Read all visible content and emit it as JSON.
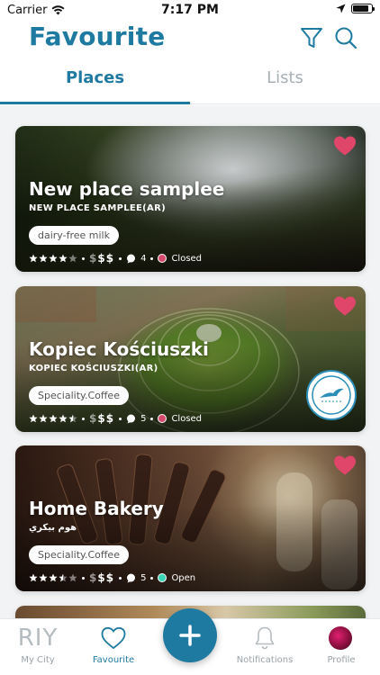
{
  "status_bar": {
    "carrier": "Carrier",
    "time": "7:17 PM"
  },
  "header": {
    "title": "Favourite",
    "filter_icon": "filter-icon",
    "search_icon": "search-icon"
  },
  "tabs": [
    {
      "label": "Places",
      "active": true
    },
    {
      "label": "Lists",
      "active": false
    }
  ],
  "colors": {
    "accent": "#1e7aa0",
    "heart": "#e0456a",
    "closed": "#d64b6b",
    "open": "#3ad6b5"
  },
  "places": [
    {
      "name": "New place samplee",
      "subtitle": "NEW PLACE SAMPLEE(AR)",
      "tag": "dairy-free milk",
      "rating": 4,
      "price_active": "$$",
      "price_inactive": "$",
      "reviews": "4",
      "status": "Closed",
      "favourite": true
    },
    {
      "name": "Kopiec Kościuszki",
      "subtitle": "KOPIEC KOŚCIUSZKI(AR)",
      "tag": "Speciality.Coffee",
      "rating": 4.5,
      "price_active": "$$",
      "price_inactive": "$",
      "reviews": "5",
      "status": "Closed",
      "favourite": true
    },
    {
      "name": "Home Bakery",
      "subtitle": "هوم بيكري",
      "tag": "Speciality.Coffee",
      "rating": 3.5,
      "price_active": "$$",
      "price_inactive": "$",
      "reviews": "5",
      "status": "Open",
      "favourite": true
    }
  ],
  "tabbar": {
    "my_city_logo": "RIY",
    "my_city": "My City",
    "favourite": "Favourite",
    "add": "plus-icon",
    "notifications": "Notifications",
    "profile": "Profile"
  }
}
